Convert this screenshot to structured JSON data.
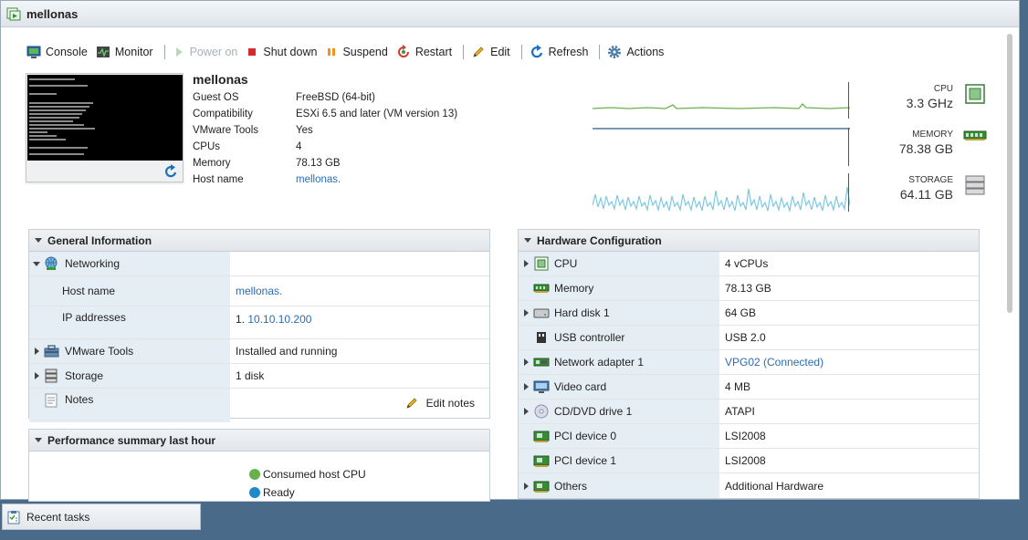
{
  "window": {
    "title": "mellonas"
  },
  "toolbar": {
    "console": "Console",
    "monitor": "Monitor",
    "power_on": "Power on",
    "shut_down": "Shut down",
    "suspend": "Suspend",
    "restart": "Restart",
    "edit": "Edit",
    "refresh": "Refresh",
    "actions": "Actions"
  },
  "vm": {
    "name": "mellonas",
    "props": [
      {
        "key": "Guest OS",
        "value": "FreeBSD (64-bit)"
      },
      {
        "key": "Compatibility",
        "value": "ESXi 6.5 and later (VM version 13)"
      },
      {
        "key": "VMware Tools",
        "value": "Yes"
      },
      {
        "key": "CPUs",
        "value": "4"
      },
      {
        "key": "Memory",
        "value": "78.13 GB"
      },
      {
        "key": "Host name",
        "value": "mellonas."
      }
    ]
  },
  "metrics": {
    "cpu": {
      "label": "CPU",
      "value": "3.3 GHz"
    },
    "memory": {
      "label": "MEMORY",
      "value": "78.38 GB"
    },
    "storage": {
      "label": "STORAGE",
      "value": "64.11 GB"
    }
  },
  "general": {
    "title": "General Information",
    "networking": "Networking",
    "host_name_label": "Host name",
    "host_name_value": "mellonas.",
    "ip_label": "IP addresses",
    "ip_index": "1.",
    "ip_value": "10.10.10.200",
    "tools_label": "VMware Tools",
    "tools_value": "Installed and running",
    "storage_label": "Storage",
    "storage_value": "1 disk",
    "notes_label": "Notes",
    "edit_notes": "Edit notes"
  },
  "perf": {
    "title": "Performance summary last hour",
    "legend_cpu": "Consumed host CPU",
    "legend_ready": "Ready"
  },
  "hardware": {
    "title": "Hardware Configuration",
    "rows": [
      {
        "label": "CPU",
        "value": "4 vCPUs"
      },
      {
        "label": "Memory",
        "value": "78.13 GB"
      },
      {
        "label": "Hard disk 1",
        "value": "64 GB"
      },
      {
        "label": "USB controller",
        "value": "USB 2.0"
      },
      {
        "label": "Network adapter 1",
        "value": "VPG02 (Connected)"
      },
      {
        "label": "Video card",
        "value": "4 MB"
      },
      {
        "label": "CD/DVD drive 1",
        "value": "ATAPI"
      },
      {
        "label": "PCI device 0",
        "value": "LSI2008"
      },
      {
        "label": "PCI device 1",
        "value": "LSI2008"
      },
      {
        "label": "Others",
        "value": "Additional Hardware"
      }
    ]
  },
  "footer": {
    "recent_tasks": "Recent tasks"
  },
  "colors": {
    "accent": "#2b6db0",
    "cpu_spark": "#6ab04c",
    "storage_spark": "#7ec8e3"
  }
}
